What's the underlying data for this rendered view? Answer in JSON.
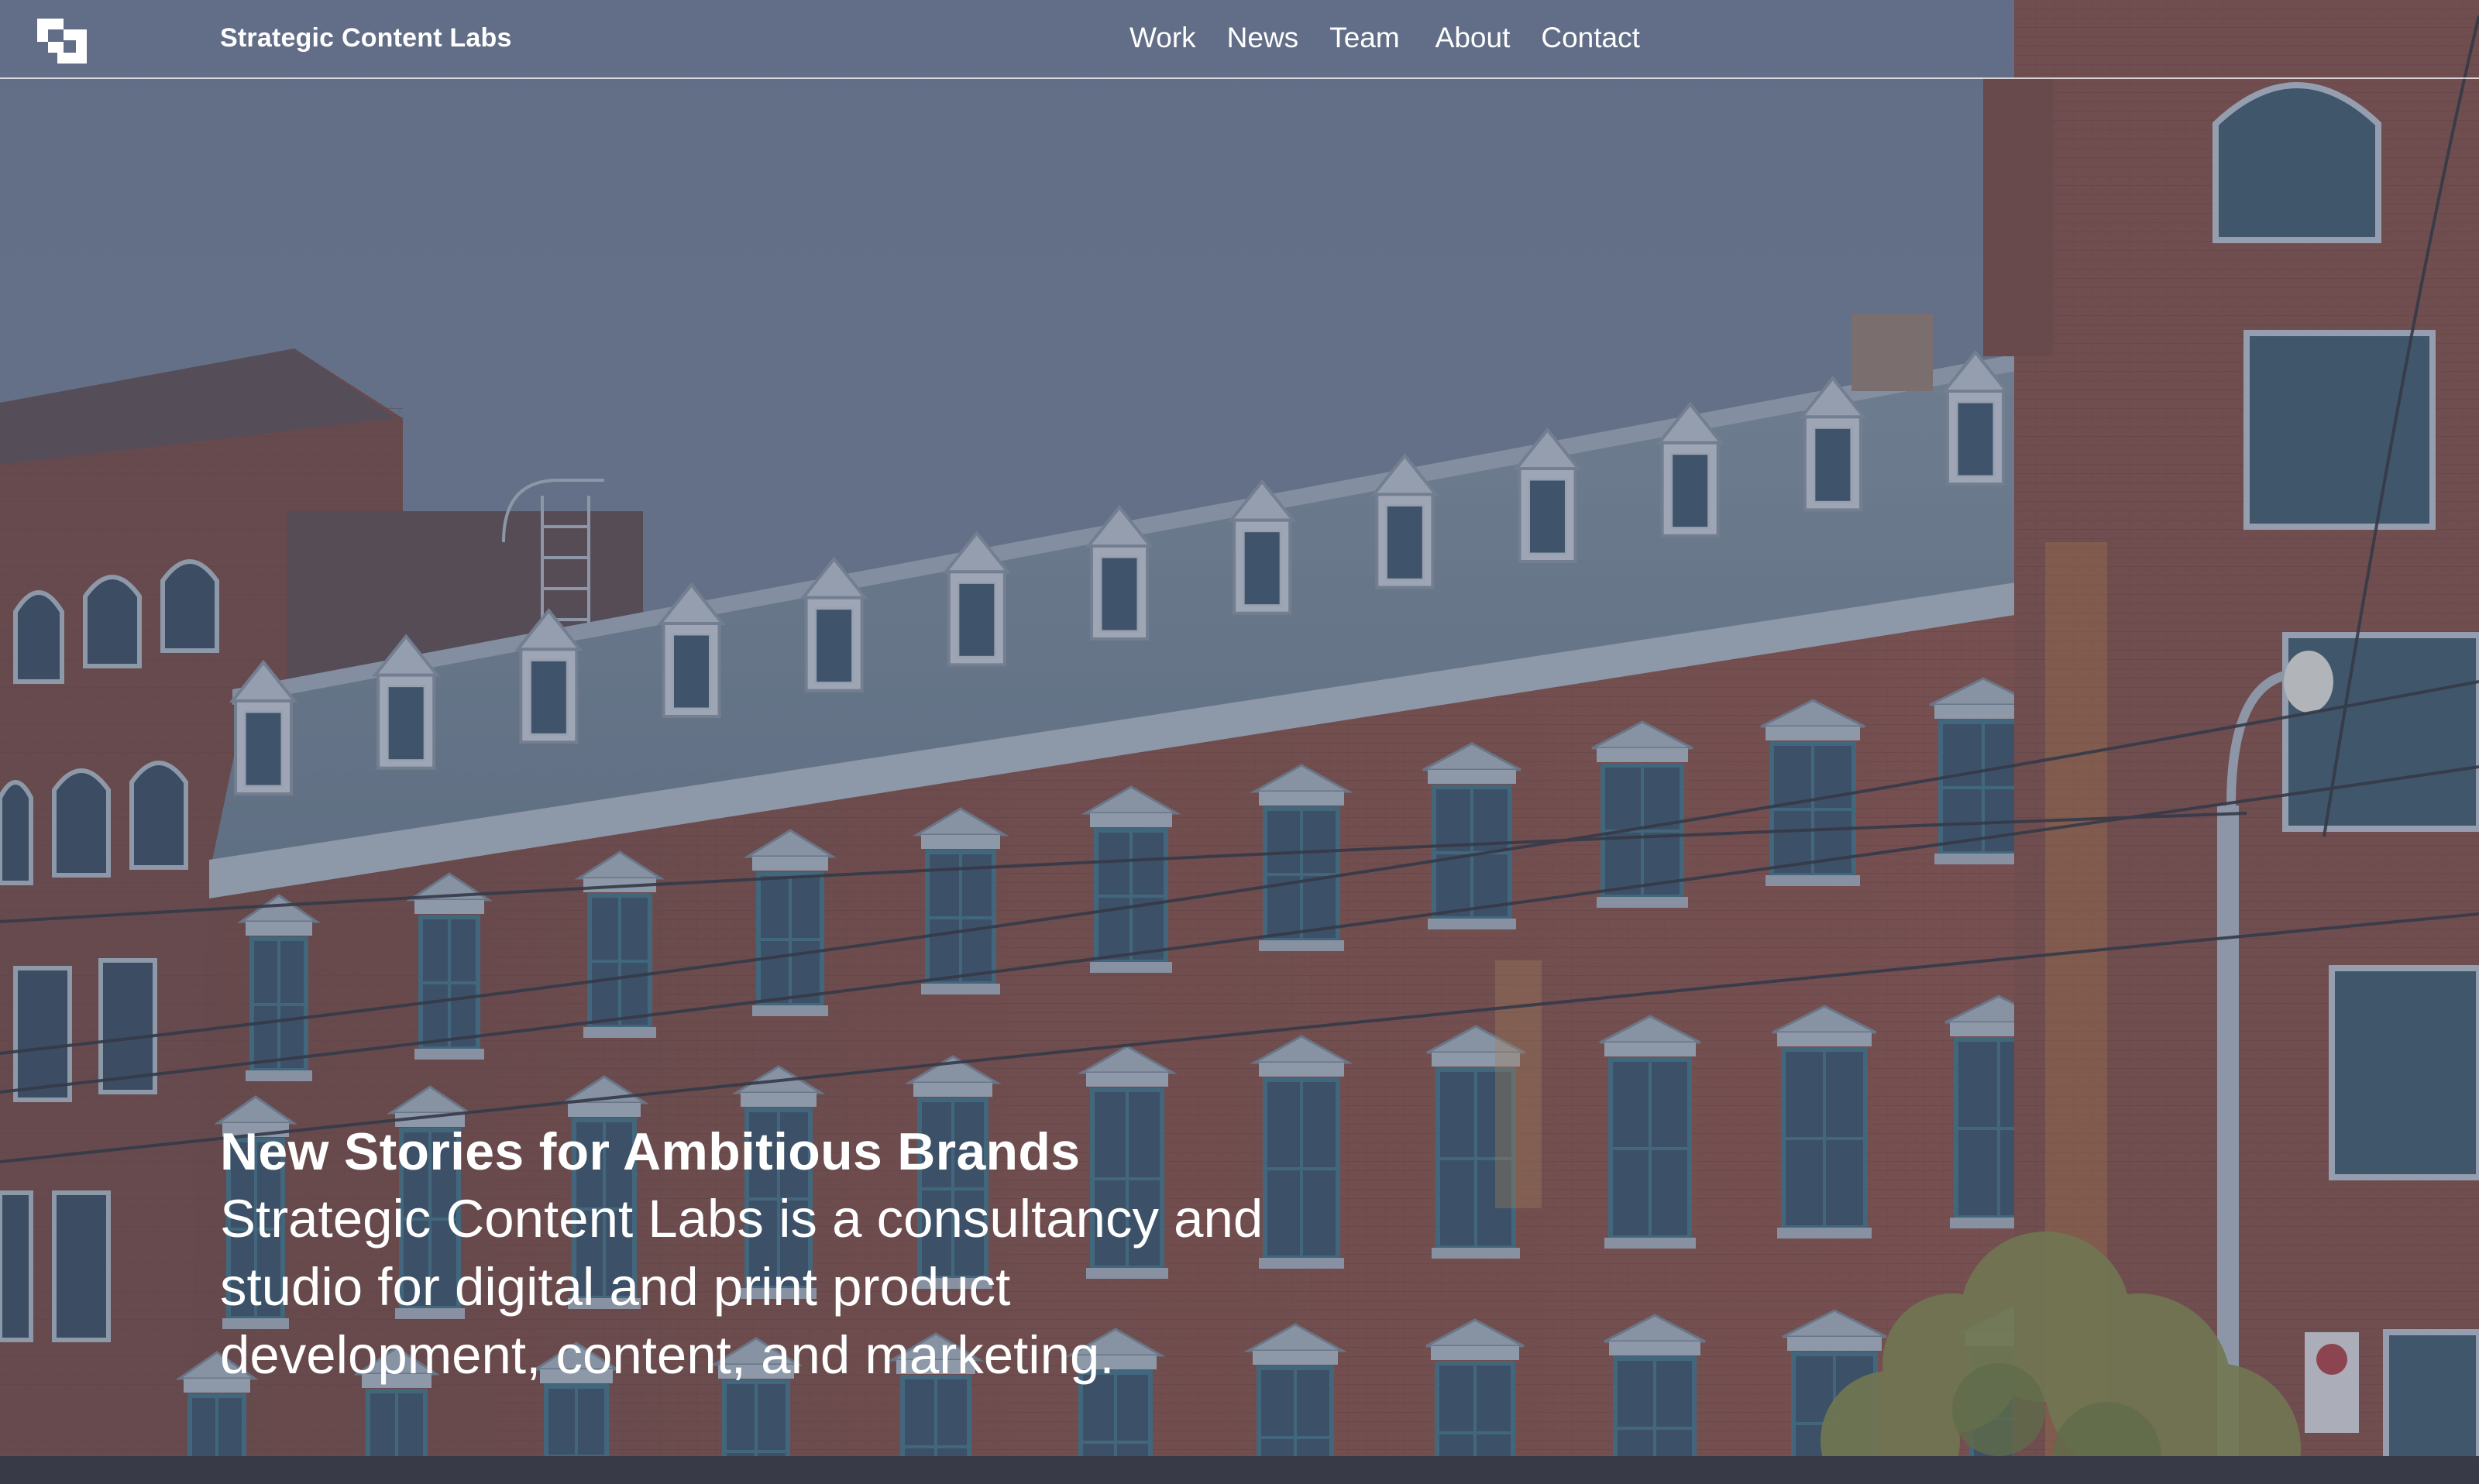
{
  "header": {
    "logo_icon": "studio-logo-icon",
    "brand": "Strategic Content Labs",
    "nav": [
      {
        "label": "Work"
      },
      {
        "label": "News"
      },
      {
        "label": "Team"
      },
      {
        "label": "About"
      },
      {
        "label": "Contact"
      }
    ]
  },
  "hero": {
    "title": "New Stories for Ambitious Brands",
    "description": "Strategic Content Labs is a consultancy and studio for digital and print product development, content, and marketing.",
    "background_image": "brick-heritage-building-photo"
  },
  "colors": {
    "sky": "#6f7a8e",
    "brick": "#8a4b3a",
    "brick_dark": "#6e3a2d",
    "roof": "#7f919c",
    "trim": "#c8cfd6",
    "window": "#3d5866",
    "text": "#ffffff"
  }
}
